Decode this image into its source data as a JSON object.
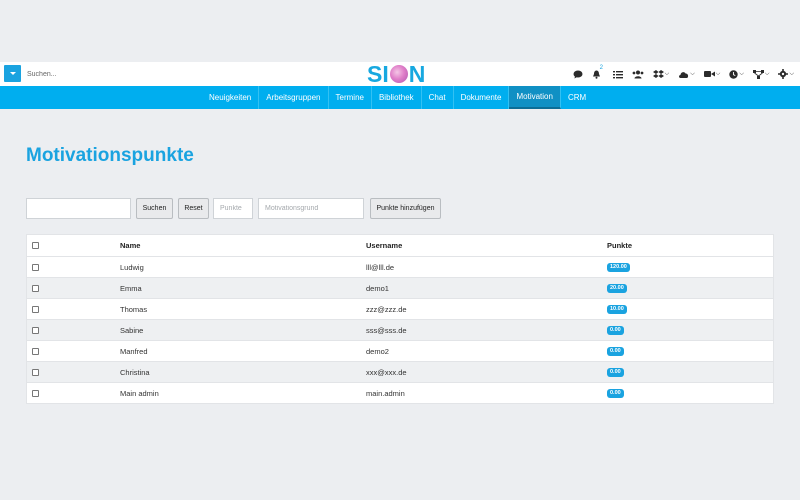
{
  "topbar": {
    "search_placeholder": "Suchen...",
    "logo": {
      "left": "SI",
      "right": "N"
    },
    "notification_count": "2",
    "icons": [
      "chat-icon",
      "bell-icon",
      "checklist-icon",
      "users-icon",
      "dropbox-icon",
      "cloud-icon",
      "video-icon",
      "clock-icon",
      "network-icon",
      "gear-icon"
    ]
  },
  "nav": {
    "items": [
      {
        "label": "Neuigkeiten"
      },
      {
        "label": "Arbeitsgruppen"
      },
      {
        "label": "Termine"
      },
      {
        "label": "Bibliothek"
      },
      {
        "label": "Chat"
      },
      {
        "label": "Dokumente"
      },
      {
        "label": "Motivation",
        "active": true
      },
      {
        "label": "CRM"
      }
    ]
  },
  "page": {
    "title": "Motivationspunkte"
  },
  "controls": {
    "search_value": "",
    "search_button": "Suchen",
    "reset_button": "Reset",
    "points_placeholder": "Punkte",
    "reason_placeholder": "Motivationsgrund",
    "add_button": "Punkte hinzufügen"
  },
  "table": {
    "headers": {
      "name": "Name",
      "username": "Username",
      "points": "Punkte"
    },
    "rows": [
      {
        "name": "Ludwig",
        "username": "lll@lll.de",
        "points": "120.00"
      },
      {
        "name": "Emma",
        "username": "demo1",
        "points": "20.00"
      },
      {
        "name": "Thomas",
        "username": "zzz@zzz.de",
        "points": "10.00"
      },
      {
        "name": "Sabine",
        "username": "sss@sss.de",
        "points": "0.00"
      },
      {
        "name": "Manfred",
        "username": "demo2",
        "points": "0.00"
      },
      {
        "name": "Christina",
        "username": "xxx@xxx.de",
        "points": "0.00"
      },
      {
        "name": "Main admin",
        "username": "main.admin",
        "points": "0.00"
      }
    ]
  },
  "colors": {
    "accent": "#00aeef",
    "title": "#1aa3e0",
    "nav_active": "#1090c4"
  }
}
